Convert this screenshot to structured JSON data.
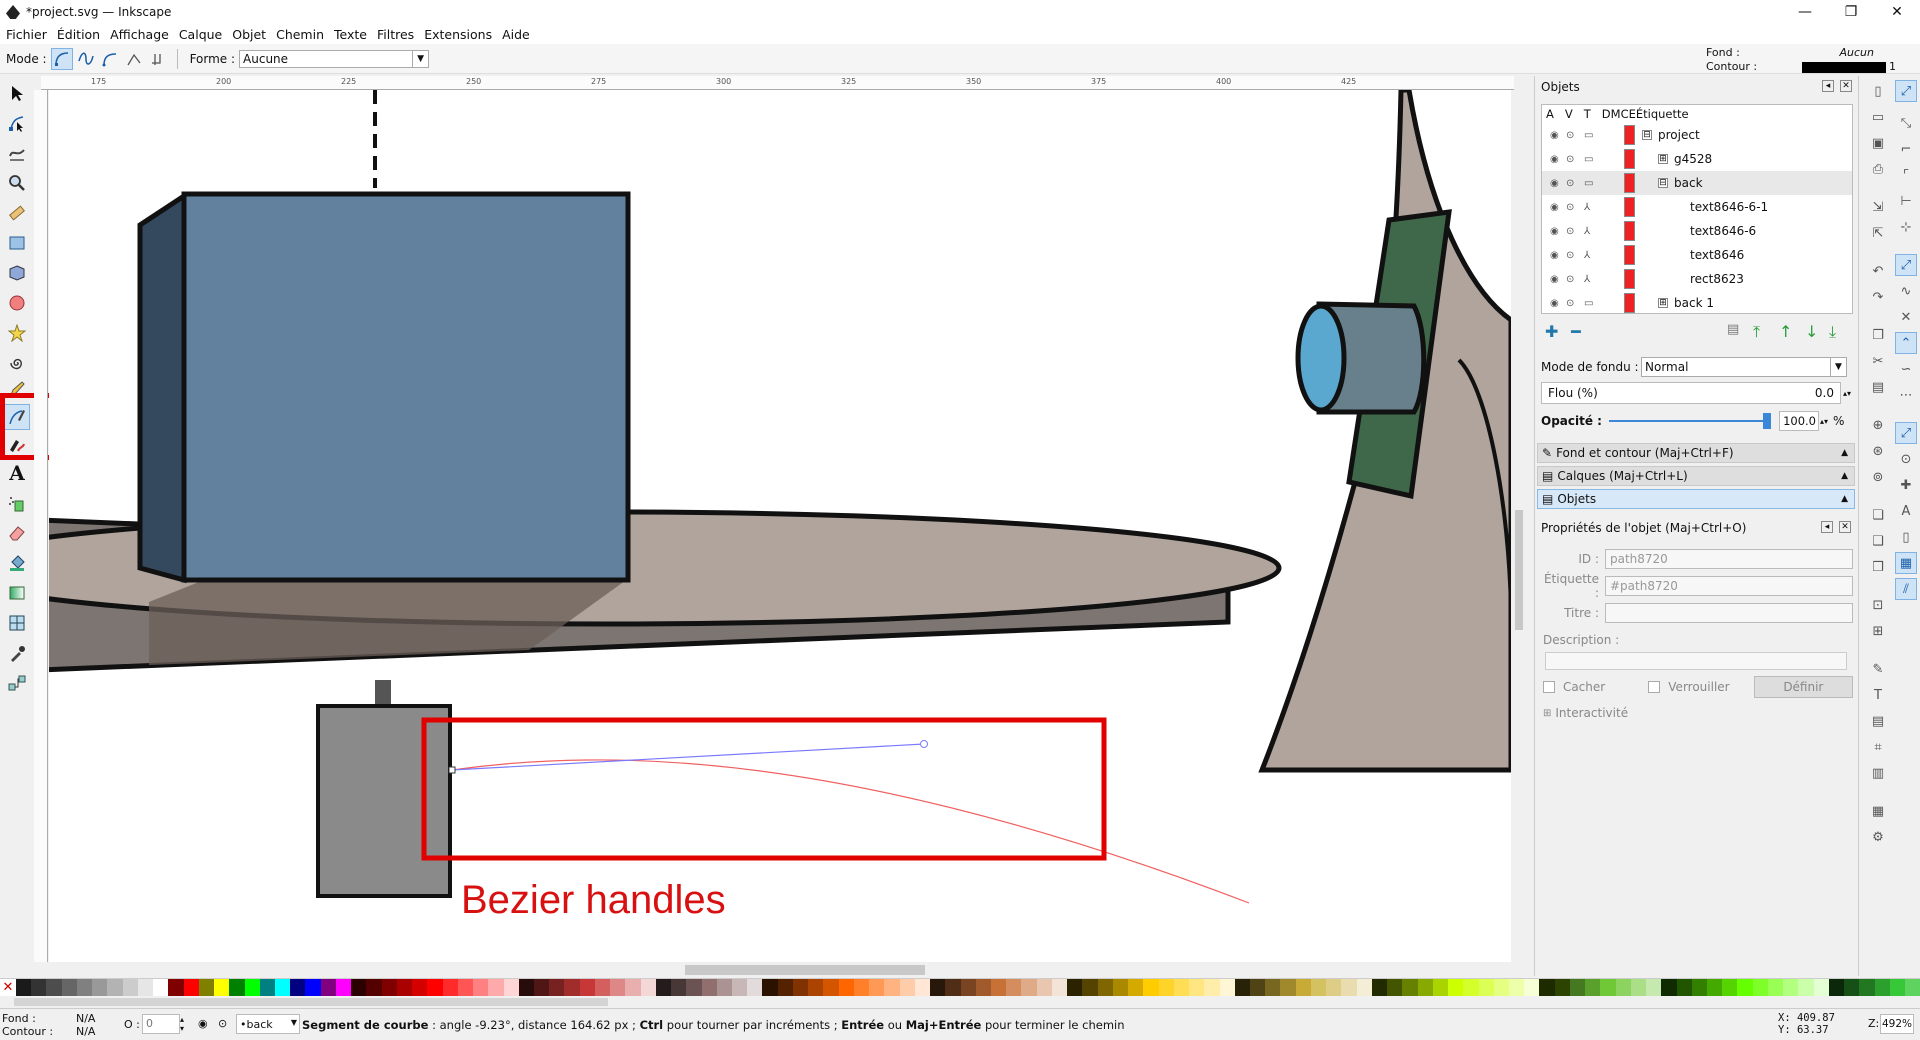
{
  "window": {
    "title": "*project.svg — Inkscape",
    "controls": [
      "—",
      "❐",
      "✕"
    ]
  },
  "menu": [
    "Fichier",
    "Édition",
    "Affichage",
    "Calque",
    "Objet",
    "Chemin",
    "Texte",
    "Filtres",
    "Extensions",
    "Aide"
  ],
  "toolbar": {
    "mode_label": "Mode :",
    "forme_label": "Forme :",
    "forme_value": "Aucune"
  },
  "style_indicator": {
    "fill_label": "Fond :",
    "fill_value": "Aucun",
    "stroke_label": "Contour :",
    "stroke_width": "1",
    "stroke_color": "#000000"
  },
  "ruler": {
    "ticks": [
      "175",
      "200",
      "225",
      "250",
      "275",
      "300",
      "325",
      "350",
      "375",
      "400",
      "425"
    ]
  },
  "canvas": {
    "annotation": "Bezier handles",
    "annotation_color": "#d81010"
  },
  "objects_panel": {
    "title": "Objets",
    "columns": [
      "A",
      "V",
      "T",
      "DM",
      "CE",
      "Étiquette"
    ],
    "rows": [
      {
        "label": "project",
        "expander": "⊟"
      },
      {
        "label": "g4528",
        "expander": "⊞"
      },
      {
        "label": "back",
        "expander": "⊟"
      },
      {
        "label": "text8646-6-1",
        "expander": ""
      },
      {
        "label": "text8646-6",
        "expander": ""
      },
      {
        "label": "text8646",
        "expander": ""
      },
      {
        "label": "rect8623",
        "expander": ""
      },
      {
        "label": "back 1",
        "expander": "⊞"
      }
    ],
    "blend_label": "Mode de fondu :",
    "blend_value": "Normal",
    "blur_label": "Flou (%)",
    "blur_value": "0.0",
    "opacity_label": "Opacité :",
    "opacity_value": "100.0",
    "opacity_unit": "%",
    "opacity_fraction": 1.0
  },
  "sections": [
    {
      "label": "Fond et contour (Maj+Ctrl+F)"
    },
    {
      "label": "Calques (Maj+Ctrl+L)"
    },
    {
      "label": "Objets"
    }
  ],
  "object_properties": {
    "title": "Propriétés de l'objet (Maj+Ctrl+O)",
    "id_label": "ID :",
    "id_value": "path8720",
    "label_label": "Étiquette :",
    "label_value": "#path8720",
    "title_label": "Titre :",
    "title_value": "",
    "description_label": "Description :",
    "hide_label": "Cacher",
    "lock_label": "Verrouiller",
    "define_label": "Définir",
    "interactivity_label": "Interactivité"
  },
  "palette": [
    "#1a1a1a",
    "#333333",
    "#4d4d4d",
    "#666666",
    "#808080",
    "#999999",
    "#b3b3b3",
    "#cccccc",
    "#e6e6e6",
    "#ffffff",
    "#800000",
    "#ff0000",
    "#808000",
    "#ffff00",
    "#008000",
    "#00ff00",
    "#008080",
    "#00ffff",
    "#000080",
    "#0000ff",
    "#800080",
    "#ff00ff",
    "#2b0000",
    "#550000",
    "#800000",
    "#aa0000",
    "#d40000",
    "#ff0000",
    "#ff2a2a",
    "#ff5555",
    "#ff8080",
    "#ffaaaa",
    "#ffd5d5",
    "#280b0b",
    "#501616",
    "#782121",
    "#a02c2c",
    "#c83737",
    "#d35f5f",
    "#de8787",
    "#e9afaf",
    "#f4d7d7",
    "#241c1c",
    "#483737",
    "#6c5353",
    "#916f6f",
    "#ac9393",
    "#c8b7b7",
    "#e3dbdb",
    "#2b1100",
    "#552200",
    "#803300",
    "#aa4400",
    "#d45500",
    "#ff6600",
    "#ff7f2a",
    "#ff9955",
    "#ffb380",
    "#ffccaa",
    "#ffe6d5",
    "#28170b",
    "#502d16",
    "#784421",
    "#a05a2c",
    "#c87137",
    "#d38d5f",
    "#deaa87",
    "#e9c6af",
    "#f4e3d7",
    "#2b2200",
    "#554400",
    "#806600",
    "#aa8800",
    "#d4aa00",
    "#ffcc00",
    "#ffd42a",
    "#ffdd55",
    "#ffe680",
    "#ffeeaa",
    "#fff6d5",
    "#282208",
    "#504416",
    "#786721",
    "#a0892c",
    "#c8ab37",
    "#d4c15f",
    "#decd87",
    "#e9ddaf",
    "#f4eed7",
    "#222b00",
    "#445500",
    "#668000",
    "#88aa00",
    "#aad400",
    "#ccff00",
    "#d4ff2a",
    "#ddff55",
    "#e5ff80",
    "#eeffaa",
    "#f6ffd5",
    "#1e2b00",
    "#2d4400",
    "#447821",
    "#5aa02c",
    "#71c837",
    "#8dd35f",
    "#aade87",
    "#c6e9af",
    "#112b00",
    "#225500",
    "#338000",
    "#44aa00",
    "#55d400",
    "#66ff00",
    "#7fff2a",
    "#99ff55",
    "#b3ff80",
    "#ccffaa",
    "#e5ffd5",
    "#0b280b",
    "#165016",
    "#217821",
    "#2ca02c",
    "#37c837",
    "#5fd35f"
  ],
  "status": {
    "fill_label": "Fond :",
    "stroke_label": "Contour :",
    "fill_value": "N/A",
    "stroke_value": "N/A",
    "opacity_label": "O :",
    "opacity_value": "0",
    "layer": "•back",
    "message_bold1": "Segment de courbe",
    "message1": " : angle -9.23°, distance 164.62 px ; ",
    "message_bold2": "Ctrl",
    "message2": " pour tourner par incréments ; ",
    "message_bold3": "Entrée",
    "message3": " ou ",
    "message_bold4": "Maj+Entrée",
    "message4": " pour terminer le chemin",
    "x": "X:  409.87",
    "y": "Y:   63.37",
    "zoom_label": "Z:",
    "zoom_value": "492%"
  }
}
